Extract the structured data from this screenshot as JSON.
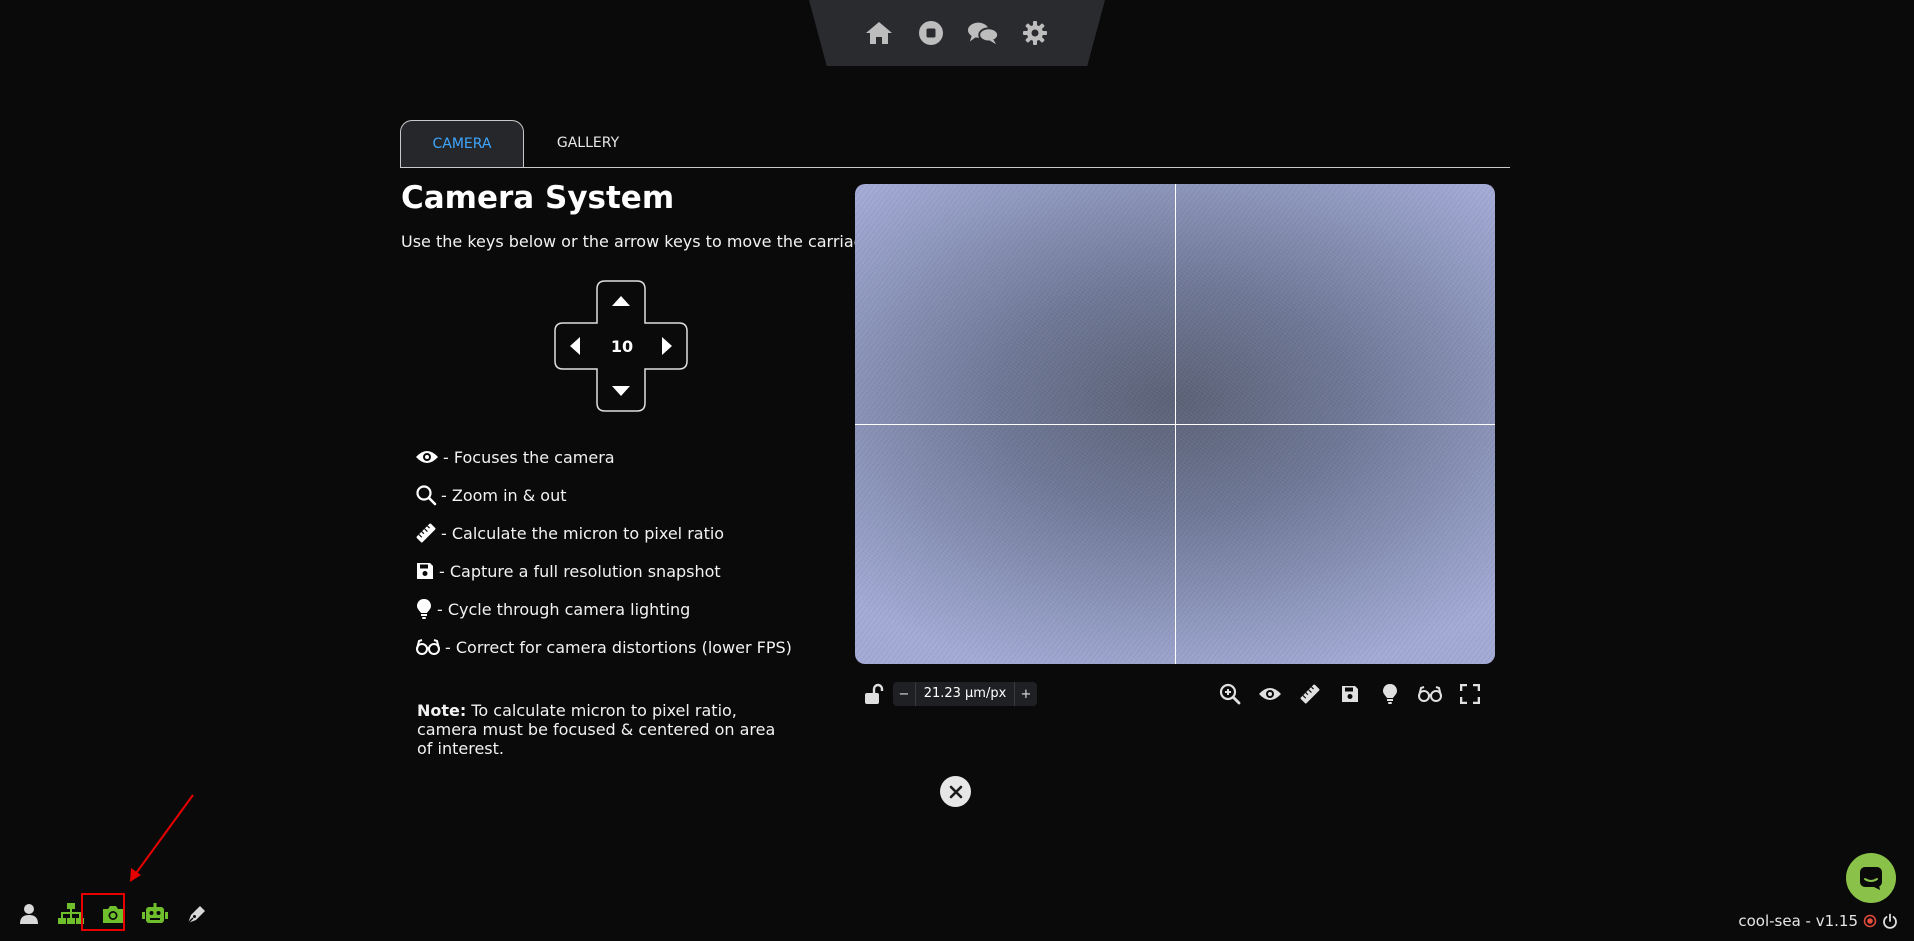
{
  "top_nav": {
    "icons": [
      "home-icon",
      "stop-icon",
      "chat-icon",
      "settings-gear-icon"
    ]
  },
  "tabs": [
    {
      "label": "CAMERA",
      "active": true
    },
    {
      "label": "GALLERY",
      "active": false
    }
  ],
  "main": {
    "title": "Camera System",
    "subtitle": "Use the keys below or the arrow keys to move the carriage.",
    "step_value": "10"
  },
  "legend": [
    {
      "icon": "eye-icon",
      "text": "- Focuses the camera"
    },
    {
      "icon": "magnifier-icon",
      "text": "- Zoom in & out"
    },
    {
      "icon": "ruler-icon",
      "text": "- Calculate the micron to pixel ratio"
    },
    {
      "icon": "save-icon",
      "text": "- Capture a full resolution snapshot"
    },
    {
      "icon": "lightbulb-icon",
      "text": "- Cycle through camera lighting"
    },
    {
      "icon": "glasses-icon",
      "text": "- Correct for camera distortions (lower FPS)"
    }
  ],
  "note": {
    "label": "Note:",
    "text": "To calculate micron to pixel ratio, camera must be focused & centered on area of interest."
  },
  "camera_controls": {
    "minus": "−",
    "ratio": "21.23 μm/px",
    "plus": "+",
    "tools": [
      "zoom-in-icon",
      "eye-icon",
      "ruler-icon",
      "save-icon",
      "lightbulb-icon",
      "glasses-icon",
      "fullscreen-icon"
    ]
  },
  "dock": {
    "icons": [
      "user-icon",
      "network-icon",
      "camera-icon",
      "robot-icon",
      "pen-icon"
    ],
    "active": "camera-icon"
  },
  "footer": {
    "version": "cool-sea - v1.15"
  },
  "colors": {
    "accent": "#3ea6ff",
    "dock_green": "#6fbf2c",
    "highlight_red": "#e60000",
    "status_red": "#e74c3c"
  }
}
